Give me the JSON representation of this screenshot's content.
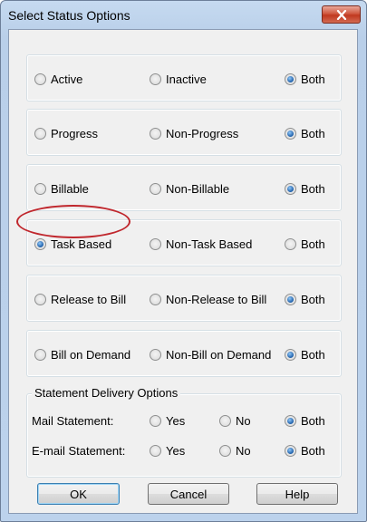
{
  "dialog": {
    "title": "Select Status Options"
  },
  "groups": [
    {
      "options": [
        "Active",
        "Inactive",
        "Both"
      ],
      "selected": 2
    },
    {
      "options": [
        "Progress",
        "Non-Progress",
        "Both"
      ],
      "selected": 2
    },
    {
      "options": [
        "Billable",
        "Non-Billable",
        "Both"
      ],
      "selected": 2
    },
    {
      "options": [
        "Task Based",
        "Non-Task Based",
        "Both"
      ],
      "selected": 0
    },
    {
      "options": [
        "Release to Bill",
        "Non-Release to Bill",
        "Both"
      ],
      "selected": 2
    },
    {
      "options": [
        "Bill on Demand",
        "Non-Bill on Demand",
        "Both"
      ],
      "selected": 2
    }
  ],
  "delivery": {
    "legend": "Statement Delivery Options",
    "rows": [
      {
        "label": "Mail Statement:",
        "options": [
          "Yes",
          "No",
          "Both"
        ],
        "selected": 2
      },
      {
        "label": "E-mail Statement:",
        "options": [
          "Yes",
          "No",
          "Both"
        ],
        "selected": 2
      }
    ]
  },
  "buttons": {
    "ok": "OK",
    "cancel": "Cancel",
    "help": "Help"
  },
  "colors": {
    "highlight": "#c0272d",
    "radio_selected": "#1d5ea8"
  }
}
